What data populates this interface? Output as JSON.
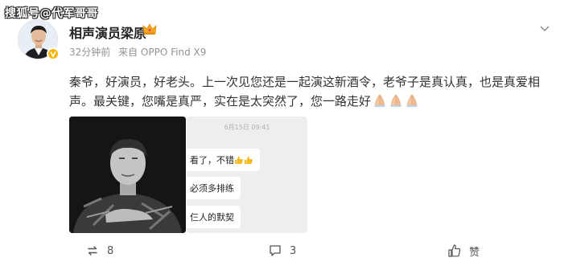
{
  "watermark": "搜狐号@代军哥哥",
  "post": {
    "author": "相声演员梁原",
    "time": "32分钟前",
    "source": "来自 OPPO Find X9",
    "text": "秦爷，好演员，好老头。上一次见您还是一起演这新酒令，老爷子是真认真，也是真爱相声。最关键，您嘴是真严，实在是太突然了，您一路走好"
  },
  "chat_image": {
    "date": "6月15日 09:41",
    "messages": [
      "看了，不错",
      "必须多排练",
      "仨人的默契"
    ]
  },
  "actions": {
    "repost_count": "8",
    "comment_count": "3",
    "like_label": "赞"
  },
  "icons": {
    "watermark_logo": "sohu-watermark",
    "vip_badge": "crown-icon",
    "verified": "verified-v-icon",
    "more": "chevron-down-icon",
    "emoji": "folded-hands-icon",
    "thumbs": "thumbs-up-icon",
    "repost": "repost-icon",
    "comment": "comment-icon",
    "like": "like-icon"
  },
  "colors": {
    "meta_text": "#939393",
    "badge_gold": "#f7b500",
    "emoji_skin": "#f6c8a0"
  }
}
